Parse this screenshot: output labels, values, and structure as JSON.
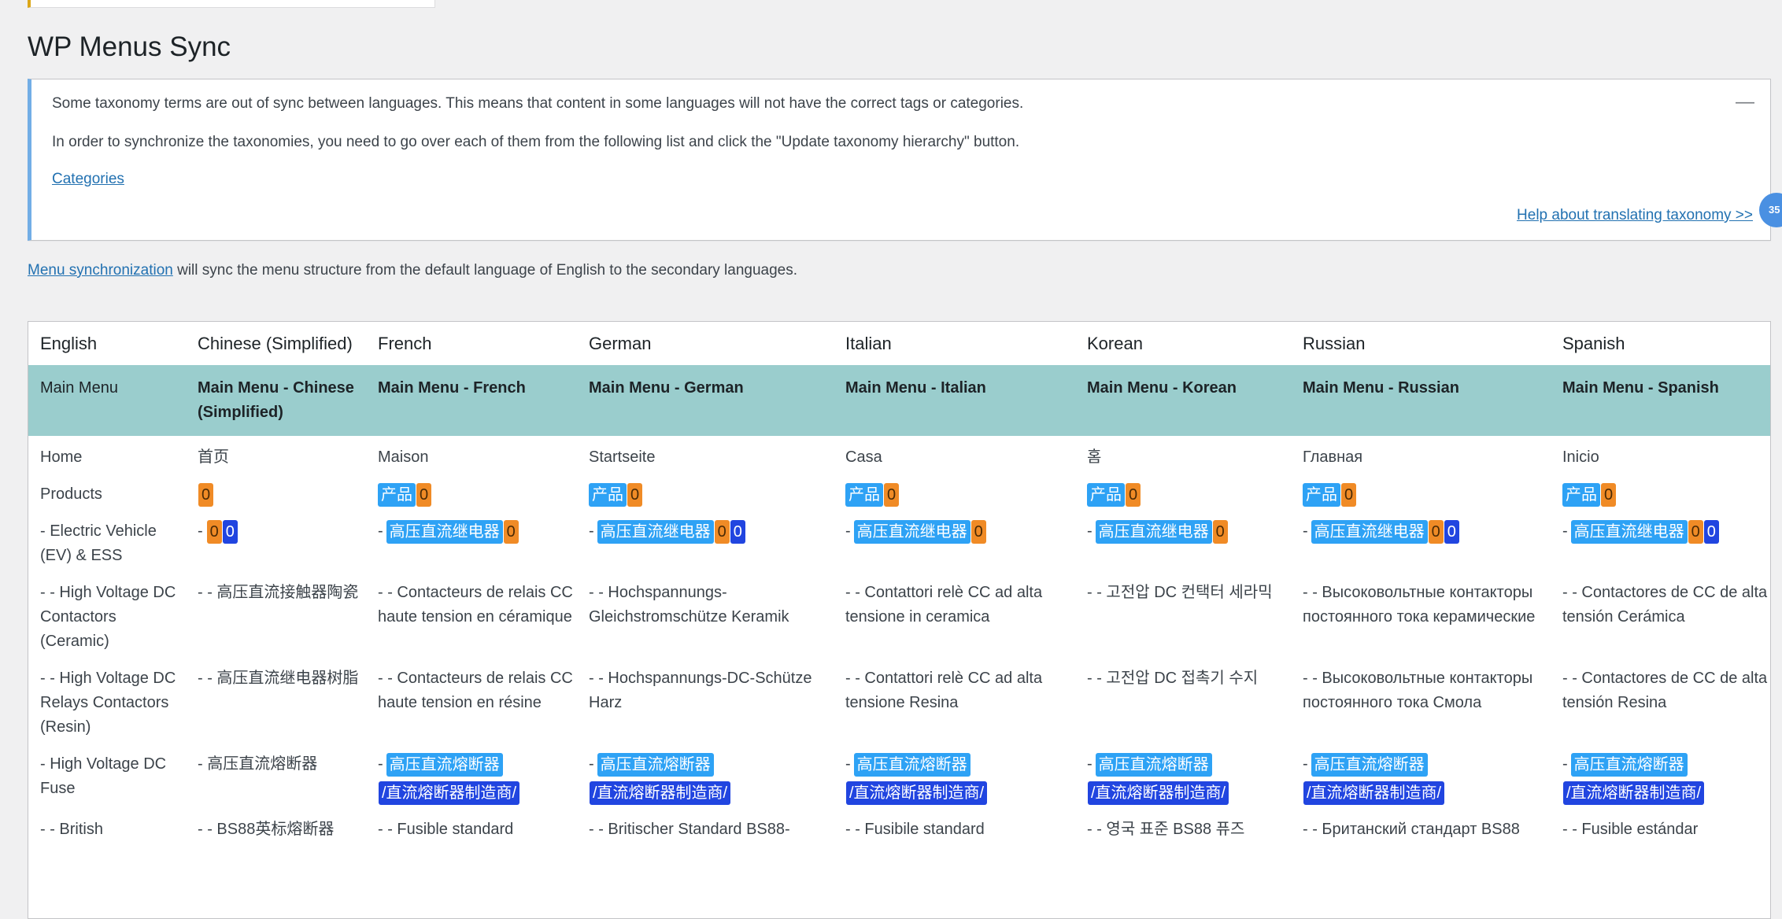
{
  "page_title": "WP Menus Sync",
  "notice": {
    "line1": "Some taxonomy terms are out of sync between languages. This means that content in some languages will not have the correct tags or categories.",
    "line2": "In order to synchronize the taxonomies, you need to go over each of them from the following list and click the \"Update taxonomy hierarchy\" button.",
    "categories_link": "Categories",
    "help_link": "Help about translating taxonomy >>",
    "dismiss_glyph": "—"
  },
  "floating_badge": "35",
  "intro": {
    "link": "Menu synchronization",
    "text": " will sync the menu structure from the default language of English to the secondary languages."
  },
  "table": {
    "headers": [
      "English",
      "Chinese (Simplified)",
      "French",
      "German",
      "Italian",
      "Korean",
      "Russian",
      "Spanish"
    ],
    "menus": [
      "Main Menu",
      "Main Menu - Chinese (Simplified)",
      "Main Menu - French",
      "Main Menu - German",
      "Main Menu - Italian",
      "Main Menu - Korean",
      "Main Menu - Russian",
      "Main Menu - Spanish"
    ],
    "rows": {
      "home": [
        "Home",
        "首页",
        "Maison",
        "Startseite",
        "Casa",
        "홈",
        "Главная",
        "Inicio"
      ],
      "products": {
        "label": "Products",
        "chip_product": "产品",
        "chip_zero": "0"
      },
      "ev": {
        "label": "- Electric Vehicle (EV) & ESS",
        "prefix": "-",
        "chip_relay": "高压直流继电器",
        "chip_zero": "0"
      },
      "hv_ceramic": [
        "- - High Voltage DC Contactors (Ceramic)",
        "- - 高压直流接触器陶瓷",
        "- - Contacteurs de relais CC haute tension en céramique",
        "- - Hochspannungs-Gleichstromschütze Keramik",
        "- - Contattori relè CC ad alta tensione in ceramica",
        "- - 고전압 DC 컨택터 세라믹",
        "- - Высоковольтные контакторы постоянного тока керамические",
        "- - Contactores de CC de alta tensión Cerámica"
      ],
      "hv_resin": [
        "- - High Voltage DC Relays Contactors (Resin)",
        "- - 高压直流继电器树脂",
        "- - Contacteurs de relais CC haute tension en résine",
        "- - Hochspannungs-DC-Schütze Harz",
        "- - Contattori relè CC ad alta tensione Resina",
        "- - 고전압 DC 접촉기 수지",
        "- - Высоковольтные контакторы постоянного тока Смола",
        "- - Contactores de CC de alta tensión Resina"
      ],
      "fuse": {
        "label": "- High Voltage DC Fuse",
        "zh": "- 高压直流熔断器",
        "prefix": "-",
        "chip_fuse": "高压直流熔断器",
        "chip_path": "/直流熔断器制造商/"
      },
      "british": [
        "- - British",
        "- - BS88英标熔断器",
        "- - Fusible standard",
        "- - Britischer Standard BS88-",
        "- - Fusibile standard",
        "- - 영국 표준 BS88 퓨즈",
        "- - Британский стандарт BS88",
        "- - Fusible estándar"
      ]
    }
  },
  "colors": {
    "menu_row_bg": "#9acdcd",
    "chip_light_blue": "#2ea2f5",
    "chip_orange": "#f08b26",
    "chip_dark_blue": "#2145e0",
    "notice_border": "#72aee6",
    "link": "#2271b1"
  }
}
